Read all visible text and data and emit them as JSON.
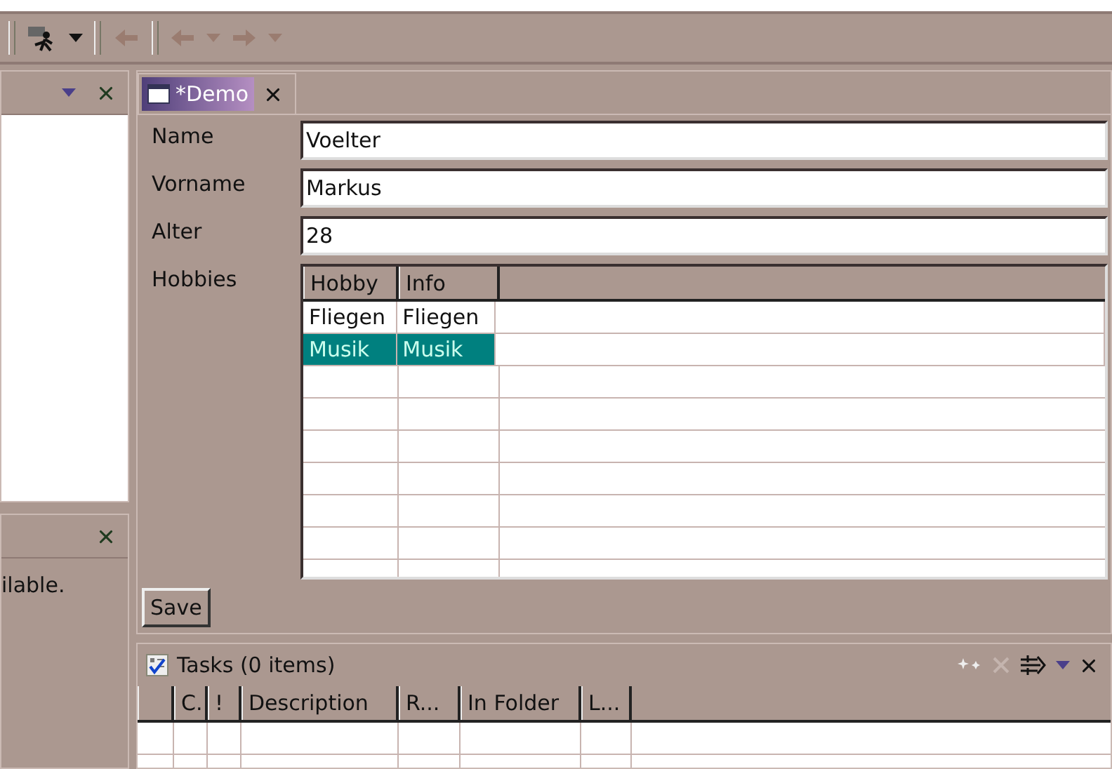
{
  "side_panel_message": "ilable.",
  "editor_tabs": [
    {
      "label": "*Demo",
      "selected": true
    }
  ],
  "form": {
    "fields": [
      {
        "label": "Name",
        "value": "Voelter"
      },
      {
        "label": "Vorname",
        "value": "Markus"
      },
      {
        "label": "Alter",
        "value": "28"
      }
    ],
    "hobbies": {
      "label": "Hobbies",
      "columns": [
        "Hobby",
        "Info"
      ],
      "rows": [
        {
          "cells": [
            "Fliegen",
            "Fliegen"
          ],
          "selected": false
        },
        {
          "cells": [
            "Musik",
            "Musik"
          ],
          "selected": true
        }
      ]
    },
    "save_button": "Save"
  },
  "tasks": {
    "title": "Tasks (0 items)",
    "columns": [
      "",
      "C.",
      "!",
      "Description",
      "R...",
      "In Folder",
      "L..."
    ]
  }
}
